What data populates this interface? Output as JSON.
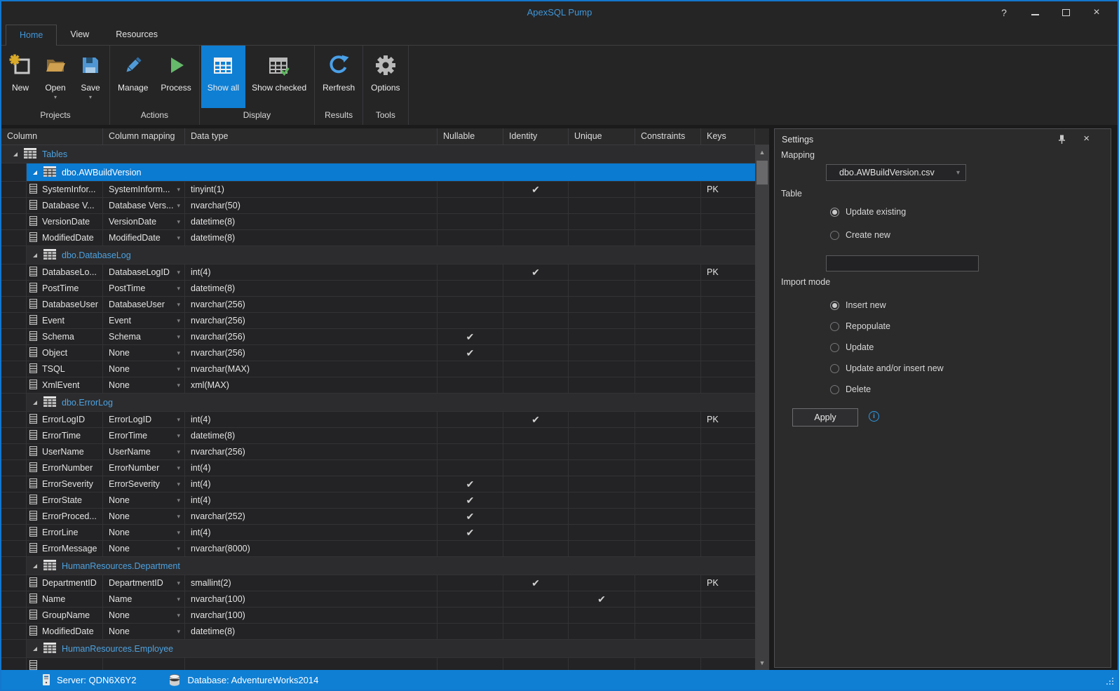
{
  "window": {
    "title": "ApexSQL Pump",
    "help": "?",
    "close": "×"
  },
  "tabs": [
    {
      "label": "Home",
      "active": true
    },
    {
      "label": "View",
      "active": false
    },
    {
      "label": "Resources",
      "active": false
    }
  ],
  "ribbon": {
    "groups": [
      {
        "label": "Projects",
        "buttons": [
          {
            "label": "New"
          },
          {
            "label": "Open",
            "dropdown": "▾"
          },
          {
            "label": "Save",
            "dropdown": "▾"
          }
        ]
      },
      {
        "label": "Actions",
        "buttons": [
          {
            "label": "Manage"
          },
          {
            "label": "Process"
          }
        ]
      },
      {
        "label": "Display",
        "buttons": [
          {
            "label": "Show all",
            "active": true
          },
          {
            "label": "Show checked"
          }
        ]
      },
      {
        "label": "Results",
        "buttons": [
          {
            "label": "Rerfresh"
          }
        ]
      },
      {
        "label": "Tools",
        "buttons": [
          {
            "label": "Options"
          }
        ]
      }
    ]
  },
  "grid": {
    "columns": [
      "Column",
      "Column mapping",
      "Data type",
      "Nullable",
      "Identity",
      "Unique",
      "Constraints",
      "Keys"
    ],
    "check_glyph": "✔",
    "rows": [
      {
        "t": "root",
        "name": "Tables"
      },
      {
        "t": "group",
        "name": "dbo.AWBuildVersion",
        "selected": true
      },
      {
        "t": "col",
        "name": "SystemInfor...",
        "map": "SystemInform...",
        "type": "tinyint(1)",
        "idn": true,
        "keys": "PK"
      },
      {
        "t": "col",
        "name": "Database V...",
        "map": "Database Vers...",
        "type": "nvarchar(50)"
      },
      {
        "t": "col",
        "name": "VersionDate",
        "map": "VersionDate",
        "type": "datetime(8)"
      },
      {
        "t": "col",
        "name": "ModifiedDate",
        "map": "ModifiedDate",
        "type": "datetime(8)"
      },
      {
        "t": "group",
        "name": "dbo.DatabaseLog"
      },
      {
        "t": "col",
        "name": "DatabaseLo...",
        "map": "DatabaseLogID",
        "type": "int(4)",
        "idn": true,
        "keys": "PK"
      },
      {
        "t": "col",
        "name": "PostTime",
        "map": "PostTime",
        "type": "datetime(8)"
      },
      {
        "t": "col",
        "name": "DatabaseUser",
        "map": "DatabaseUser",
        "type": "nvarchar(256)"
      },
      {
        "t": "col",
        "name": "Event",
        "map": "Event",
        "type": "nvarchar(256)"
      },
      {
        "t": "col",
        "name": "Schema",
        "map": "Schema",
        "type": "nvarchar(256)",
        "nul": true
      },
      {
        "t": "col",
        "name": "Object",
        "map": "None",
        "type": "nvarchar(256)",
        "nul": true
      },
      {
        "t": "col",
        "name": "TSQL",
        "map": "None",
        "type": "nvarchar(MAX)"
      },
      {
        "t": "col",
        "name": "XmlEvent",
        "map": "None",
        "type": "xml(MAX)"
      },
      {
        "t": "group",
        "name": "dbo.ErrorLog"
      },
      {
        "t": "col",
        "name": "ErrorLogID",
        "map": "ErrorLogID",
        "type": "int(4)",
        "idn": true,
        "keys": "PK"
      },
      {
        "t": "col",
        "name": "ErrorTime",
        "map": "ErrorTime",
        "type": "datetime(8)"
      },
      {
        "t": "col",
        "name": "UserName",
        "map": "UserName",
        "type": "nvarchar(256)"
      },
      {
        "t": "col",
        "name": "ErrorNumber",
        "map": "ErrorNumber",
        "type": "int(4)"
      },
      {
        "t": "col",
        "name": "ErrorSeverity",
        "map": "ErrorSeverity",
        "type": "int(4)",
        "nul": true
      },
      {
        "t": "col",
        "name": "ErrorState",
        "map": "None",
        "type": "int(4)",
        "nul": true
      },
      {
        "t": "col",
        "name": "ErrorProced...",
        "map": "None",
        "type": "nvarchar(252)",
        "nul": true
      },
      {
        "t": "col",
        "name": "ErrorLine",
        "map": "None",
        "type": "int(4)",
        "nul": true
      },
      {
        "t": "col",
        "name": "ErrorMessage",
        "map": "None",
        "type": "nvarchar(8000)"
      },
      {
        "t": "group",
        "name": "HumanResources.Department"
      },
      {
        "t": "col",
        "name": "DepartmentID",
        "map": "DepartmentID",
        "type": "smallint(2)",
        "idn": true,
        "keys": "PK"
      },
      {
        "t": "col",
        "name": "Name",
        "map": "Name",
        "type": "nvarchar(100)",
        "unq": true
      },
      {
        "t": "col",
        "name": "GroupName",
        "map": "None",
        "type": "nvarchar(100)"
      },
      {
        "t": "col",
        "name": "ModifiedDate",
        "map": "None",
        "type": "datetime(8)"
      },
      {
        "t": "group",
        "name": "HumanResources.Employee"
      },
      {
        "t": "col",
        "name": "",
        "map": "",
        "type": ""
      }
    ]
  },
  "settings": {
    "title": "Settings",
    "mapping_label": "Mapping",
    "mapping_value": "dbo.AWBuildVersion.csv",
    "table_label": "Table",
    "table_options": [
      {
        "label": "Update existing",
        "selected": true
      },
      {
        "label": "Create new",
        "selected": false
      }
    ],
    "new_table_name": "",
    "import_mode_label": "Import mode",
    "import_modes": [
      {
        "label": "Insert new",
        "selected": true
      },
      {
        "label": "Repopulate",
        "selected": false
      },
      {
        "label": "Update",
        "selected": false
      },
      {
        "label": "Update and/or insert new",
        "selected": false
      },
      {
        "label": "Delete",
        "selected": false
      }
    ],
    "apply_label": "Apply"
  },
  "statusbar": {
    "server_label": "Server: QDN6X6Y2",
    "database_label": "Database: AdventureWorks2014"
  },
  "colors": {
    "accent_blue": "#0f7fd4",
    "link_blue": "#4da2e0",
    "folder_tan": "#cfa04f",
    "save_blue": "#4f97d4",
    "process_green": "#66b86a",
    "gear_gray": "#b9b9b9",
    "check_gray": "#d2d2d2"
  }
}
